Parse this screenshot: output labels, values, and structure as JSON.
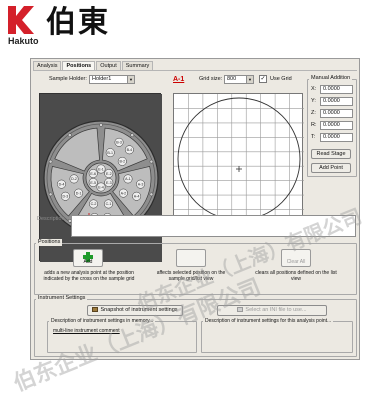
{
  "brand": {
    "name": "伯東",
    "sub": "Hakuto",
    "logo_color": "#d4202a"
  },
  "tabs": [
    "Analysis",
    "Positions",
    "Output",
    "Summary"
  ],
  "active_tab": "Positions",
  "sample_holder": {
    "label": "Sample Holder:",
    "value": "Holder1"
  },
  "grid": {
    "title": "A-1",
    "size_label": "Grid size:",
    "size_value": "800",
    "use_grid_label": "Use Grid",
    "use_grid_checked": true
  },
  "manual": {
    "title": "Manual Addition",
    "fields": [
      {
        "label": "X:",
        "value": "0.0000"
      },
      {
        "label": "Y:",
        "value": "0.0000"
      },
      {
        "label": "Z:",
        "value": "0.0000"
      },
      {
        "label": "R:",
        "value": "0.0000"
      },
      {
        "label": "T:",
        "value": "0.0000"
      }
    ],
    "read_stage": "Read Stage",
    "add_point": "Add Point"
  },
  "description_label": "Description:",
  "positions": {
    "title": "Positions",
    "add_label": "Add",
    "add_desc": "adds a new analysis point at the position indicated by the cross on the sample grid",
    "update_desc": "affects selected position on the sample grid/list view",
    "clear_label": "Clear All",
    "clear_desc": "clears all positions defined on the list view"
  },
  "instrument": {
    "title": "Instrument Settings",
    "snapshot_label": "Snapshot of instrument settings",
    "select_label": "Select an INI file to use...",
    "memory_desc": "Description of instrument settings in memory...",
    "memory_value": "multi-line instrument comment",
    "file_desc": "Description of instrument settings for this analysis point..."
  },
  "holder_slots": [
    {
      "label": "E-1"
    },
    {
      "label": "E-2"
    },
    {
      "label": "E-3"
    },
    {
      "label": "E-4"
    },
    {
      "label": "E-5"
    },
    {
      "label": "E-6"
    },
    {
      "label": "B-1"
    },
    {
      "label": "B-2"
    },
    {
      "label": "B-3"
    },
    {
      "label": "B-4"
    },
    {
      "label": "A-1"
    },
    {
      "label": "A-2"
    },
    {
      "label": "A-3"
    },
    {
      "label": "A-4"
    },
    {
      "label": "C-1"
    },
    {
      "label": "C-2"
    },
    {
      "label": "C-3"
    },
    {
      "label": "C-4"
    },
    {
      "label": "D-1"
    },
    {
      "label": "D-2"
    },
    {
      "label": "D-3"
    },
    {
      "label": "D-4"
    }
  ],
  "watermark": {
    "line1": "伯东企业（上海）有限公司",
    "line2": "伯东企业（上海）有限公司"
  }
}
